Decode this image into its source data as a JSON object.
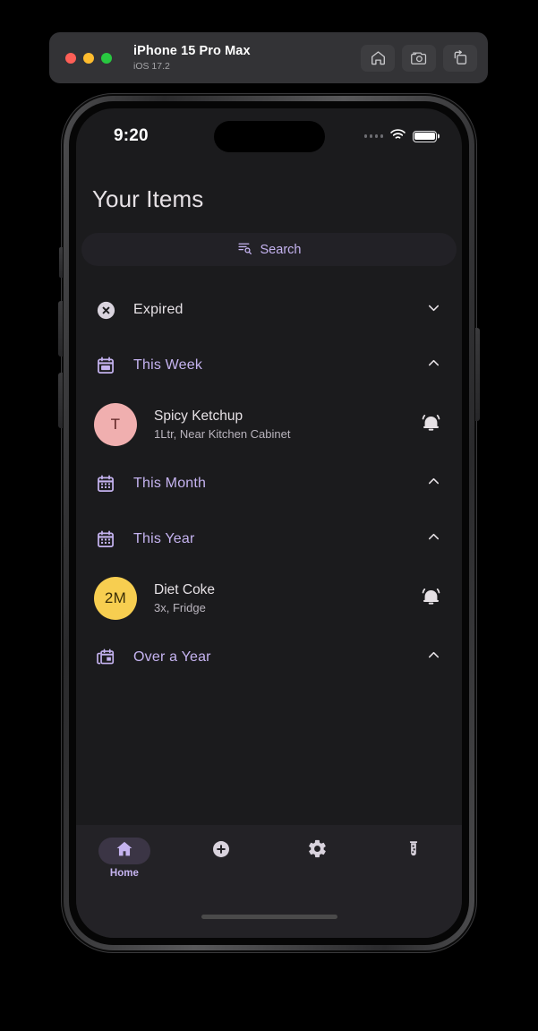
{
  "simulator": {
    "device_name": "iPhone 15 Pro Max",
    "os_version": "iOS 17.2",
    "window_controls": [
      "close",
      "minimize",
      "zoom"
    ],
    "toolbar_icons": [
      "home-icon",
      "screenshot-camera-icon",
      "rotate-device-icon"
    ]
  },
  "status_bar": {
    "time": "9:20",
    "cellular_icon": "signal-dots-icon",
    "wifi_icon": "wifi-icon",
    "battery_icon": "battery-full-icon"
  },
  "app": {
    "title": "Your Items",
    "search": {
      "label": "Search",
      "icon": "search-filter-icon",
      "accent_color": "#c5b3f0"
    },
    "sections": [
      {
        "id": "expired",
        "label": "Expired",
        "icon": "cancel-circle-icon",
        "icon_style": "white",
        "label_color": "#e6e1e5",
        "expanded": false,
        "chevron": "chevron-down-icon",
        "items": []
      },
      {
        "id": "this-week",
        "label": "This Week",
        "icon": "calendar-today-icon",
        "icon_style": "purple",
        "label_color": "#c5b3f0",
        "expanded": true,
        "chevron": "chevron-up-icon",
        "items": [
          {
            "avatar_text": "T",
            "avatar_bg": "#f0afaf",
            "avatar_fg": "#5e2424",
            "title": "Spicy Ketchup",
            "subtitle": "1Ltr, Near Kitchen Cabinet",
            "trailing_icon": "notification-bell-active-icon"
          }
        ]
      },
      {
        "id": "this-month",
        "label": "This Month",
        "icon": "calendar-month-icon",
        "icon_style": "purple",
        "label_color": "#c5b3f0",
        "expanded": true,
        "chevron": "chevron-up-icon",
        "items": []
      },
      {
        "id": "this-year",
        "label": "This Year",
        "icon": "calendar-month-icon",
        "icon_style": "purple",
        "label_color": "#c5b3f0",
        "expanded": true,
        "chevron": "chevron-up-icon",
        "items": [
          {
            "avatar_text": "2M",
            "avatar_bg": "#f7ce50",
            "avatar_fg": "#3a2e08",
            "title": "Diet Coke",
            "subtitle": "3x, Fridge",
            "trailing_icon": "notification-bell-active-icon"
          }
        ]
      },
      {
        "id": "over-a-year",
        "label": "Over a Year",
        "icon": "calendar-stack-icon",
        "icon_style": "purple",
        "label_color": "#c5b3f0",
        "expanded": true,
        "chevron": "chevron-up-icon",
        "items": []
      }
    ],
    "bottom_nav": {
      "active_index": 0,
      "items": [
        {
          "id": "home",
          "icon": "home-filled-icon",
          "label": "Home",
          "active": true
        },
        {
          "id": "add",
          "icon": "add-circle-icon",
          "label": "",
          "active": false
        },
        {
          "id": "settings",
          "icon": "gear-icon",
          "label": "",
          "active": false
        },
        {
          "id": "lab",
          "icon": "test-tube-icon",
          "label": "",
          "active": false
        }
      ]
    }
  },
  "colors": {
    "app_background": "#1b1b1d",
    "nav_background": "#232226",
    "accent_purple": "#c5b3f0",
    "pill_purple": "#3b3545",
    "text_primary": "#e6e1e5",
    "text_secondary": "#b9b4bd"
  }
}
